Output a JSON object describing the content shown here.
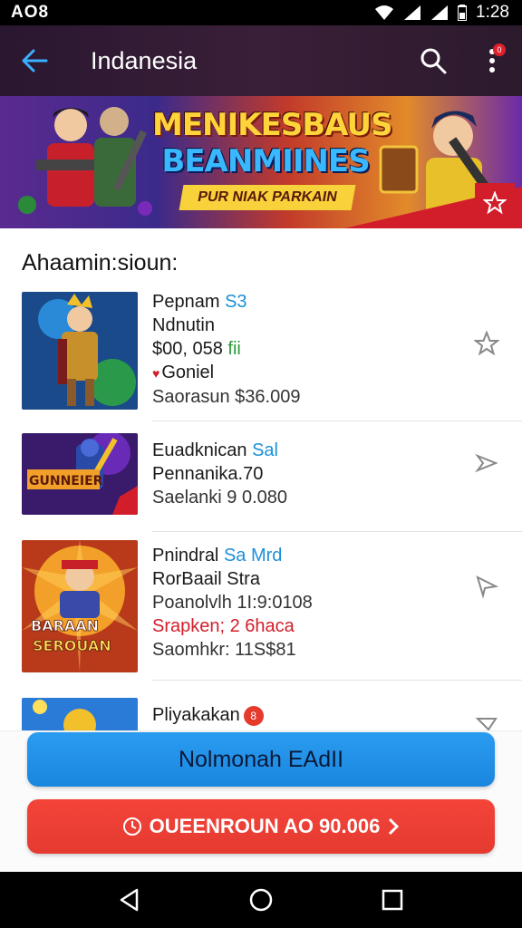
{
  "status_bar": {
    "carrier": "AO8",
    "time": "1:28"
  },
  "app_bar": {
    "title": "Indanesia",
    "notification_count": "0"
  },
  "banner": {
    "title_line1": "MENIKESBAUS",
    "title_line2": "BEANMIINES",
    "subtitle": "PUR NIAK PARKAIN"
  },
  "section": {
    "title": "Ahaamin:sioun:"
  },
  "items": [
    {
      "line1_a": "Pepnam",
      "line1_b": "S3",
      "line2": "Ndnutin",
      "line3_a": "$00, 058",
      "line3_b": "fii",
      "line4": "Goniel",
      "line5": "Saorasun $36.009"
    },
    {
      "line1_a": "Euadknican",
      "line1_b": "Sal",
      "line2": "Pennanika.70",
      "line3": "Saelanki 9 0.080",
      "thumb_text": "GUNNEIER"
    },
    {
      "line1_a": "Pnindral",
      "line1_b": "Sa Mrd",
      "line2": "RorBaail Stra",
      "line3": "Poanolvlh 1I:9:0108",
      "line4": "Srapken; 2 6haca",
      "line5": "Saomhkr: 11S$81",
      "thumb_text_1": "BARAAN",
      "thumb_text_2": "SEROUAN"
    },
    {
      "line1": "Pliyakakan",
      "badge": "8"
    }
  ],
  "buttons": {
    "primary": "Nolmonah EAdII",
    "danger": "OUEENROUN AO 90.006"
  },
  "colors": {
    "primary": "#1a86de",
    "danger": "#e43a30",
    "app_bar": "#2a1730"
  }
}
